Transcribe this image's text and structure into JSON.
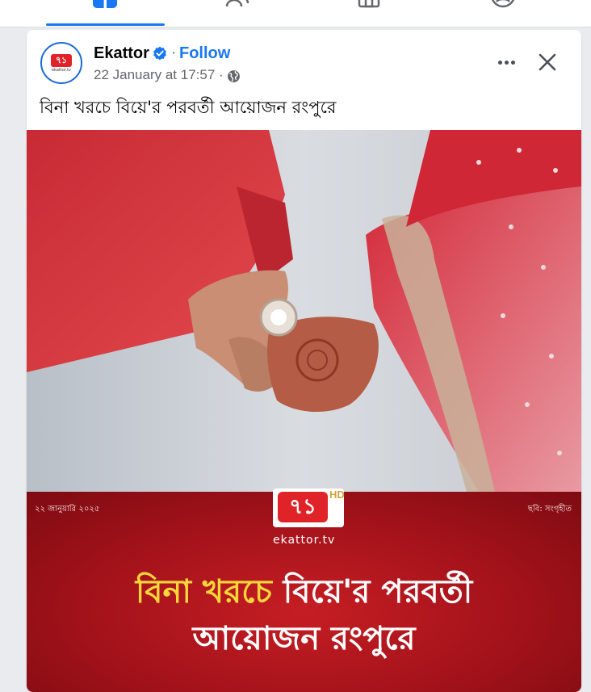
{
  "nav": {
    "tabs": [
      {
        "name": "home",
        "icon": "facebook-home-icon",
        "active": true
      },
      {
        "name": "friends",
        "icon": "friends-icon",
        "active": false
      },
      {
        "name": "marketplace",
        "icon": "marketplace-icon",
        "active": false
      },
      {
        "name": "profile",
        "icon": "profile-icon",
        "active": false
      }
    ],
    "accent_color": "#1877f2"
  },
  "post": {
    "page_name": "Ekattor",
    "verified": true,
    "separator": "·",
    "follow_label": "Follow",
    "timestamp": "22 January at 17:57 ·",
    "audience_icon": "globe-icon",
    "caption": "বিনা খরচে বিয়ে'র পরবর্তী আয়োজন রংপুরে",
    "avatar": {
      "logo_text": "৭১",
      "logo_sub": "ekattor.tv"
    }
  },
  "image": {
    "banner": {
      "date": "২২ জানুয়ারি ২০২৫",
      "credit": "ছবি: সংগৃহীত",
      "logo_number": "৭১",
      "logo_badge": "HD",
      "website": "ekattor.tv",
      "headline_part1": "বিনা খরচে",
      "headline_part2": "বিয়ে'র পরবর্তী",
      "headline_line2": "আয়োজন রংপুরে"
    }
  }
}
